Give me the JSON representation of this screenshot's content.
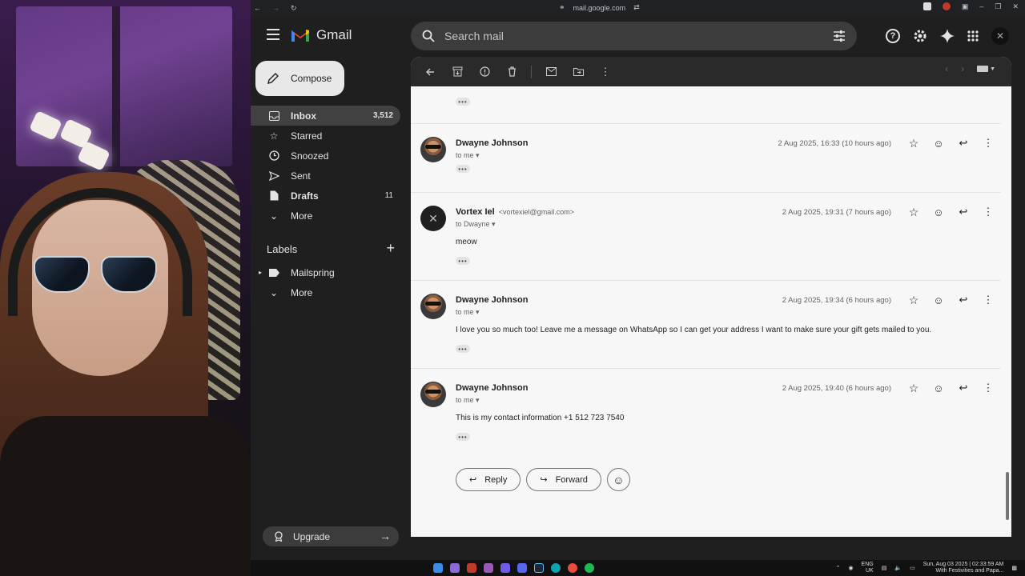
{
  "browser": {
    "url": "mail.google.com"
  },
  "gmail": {
    "app_name": "Gmail",
    "search_placeholder": "Search mail",
    "compose_label": "Compose",
    "nav": [
      {
        "label": "Inbox",
        "count": "3,512",
        "icon": "inbox-icon"
      },
      {
        "label": "Starred",
        "count": "",
        "icon": "star-icon"
      },
      {
        "label": "Snoozed",
        "count": "",
        "icon": "clock-icon"
      },
      {
        "label": "Sent",
        "count": "",
        "icon": "send-icon"
      },
      {
        "label": "Drafts",
        "count": "11",
        "icon": "draft-icon"
      },
      {
        "label": "More",
        "count": "",
        "icon": "chevron-down-icon"
      }
    ],
    "labels_heading": "Labels",
    "labels": [
      {
        "label": "Mailspring",
        "icon": "label-icon"
      },
      {
        "label": "More",
        "icon": "chevron-down-icon"
      }
    ],
    "upgrade_label": "Upgrade"
  },
  "thread": {
    "messages": [
      {
        "sender": "Dwayne Johnson",
        "address": "",
        "to": "to me",
        "date": "2 Aug 2025, 16:33 (10 hours ago)",
        "body": ""
      },
      {
        "sender": "Vortex Iel",
        "address": "<vortexiel@gmail.com>",
        "to": "to Dwayne",
        "date": "2 Aug 2025, 19:31 (7 hours ago)",
        "body": "meow"
      },
      {
        "sender": "Dwayne Johnson",
        "address": "",
        "to": "to me",
        "date": "2 Aug 2025, 19:34 (6 hours ago)",
        "body": "I love you so much too! Leave me a message on WhatsApp so I can get your address I want to make sure your gift gets mailed to you."
      },
      {
        "sender": "Dwayne Johnson",
        "address": "",
        "to": "to me",
        "date": "2 Aug 2025, 19:40 (6 hours ago)",
        "body": "This is my contact information  +1 512 723 7540"
      }
    ],
    "reply_label": "Reply",
    "forward_label": "Forward"
  },
  "taskbar": {
    "lang_top": "ENG",
    "lang_bottom": "UK",
    "clock_top": "Sun, Aug 03 2025 | 02:33:59 AM",
    "clock_bottom": "With Festivities and Papa..."
  },
  "colors": {
    "gmail_bg": "#1f1f1f",
    "thread_bg": "#f7f7f7",
    "active_nav": "#414141"
  }
}
